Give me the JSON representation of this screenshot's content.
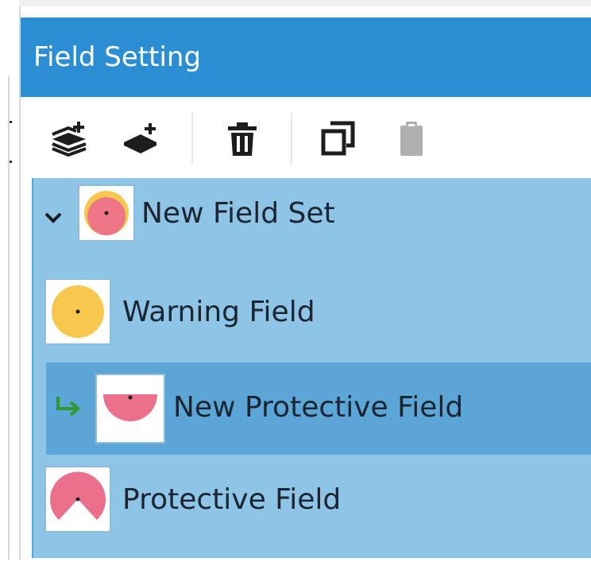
{
  "panel": {
    "title": "Field Setting"
  },
  "toolbar": {
    "buttons": [
      {
        "icon": "add-field-set-icon"
      },
      {
        "icon": "add-field-icon"
      },
      {
        "icon": "delete-icon"
      },
      {
        "icon": "copy-icon"
      },
      {
        "icon": "paste-icon",
        "enabled": false
      }
    ]
  },
  "tree": {
    "field_set": {
      "label": "New Field Set",
      "expanded": true,
      "icon": "field-set-thumbnail"
    },
    "fields": [
      {
        "label": "Warning Field",
        "icon": "warning-field-thumbnail",
        "selected": false
      },
      {
        "label": "New Protective Field",
        "icon": "protective-field-thumbnail",
        "selected": true,
        "marker": "green-return-arrow-icon"
      },
      {
        "label": "Protective Field",
        "icon": "protective-field-thumbnail",
        "selected": false
      }
    ]
  },
  "colors": {
    "title_bar": "#2b8ed3",
    "tree_background": "#8ec5e6",
    "selected_row": "#5ba6d6",
    "warning_field": "#f8c74e",
    "protective_field": "#ec6f8c",
    "marker_green": "#2e9b2e",
    "disabled_icon": "#b0b0b0"
  }
}
